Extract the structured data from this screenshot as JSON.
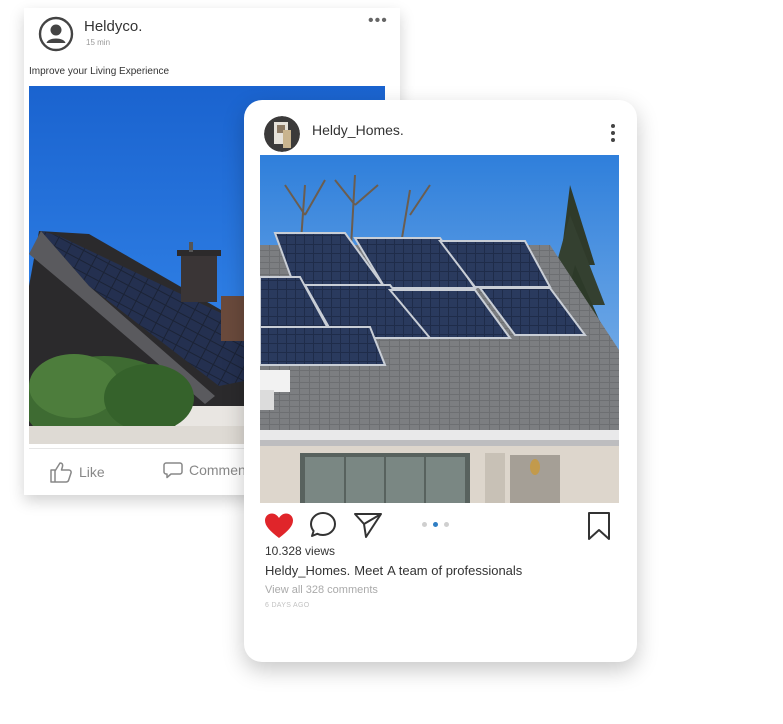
{
  "facebook_post": {
    "author": "Heldyco.",
    "time": "15 min",
    "more_icon": "more-horizontal-icon",
    "caption": "Improve your Living Experience",
    "actions": {
      "like_label": "Like",
      "comment_label": "Comment"
    }
  },
  "instagram_post": {
    "username": "Heldy_Homes.",
    "more_icon": "more-vertical-icon",
    "views": "10.328 views",
    "caption_user": "Heldy_Homes.",
    "caption_meet": "Meet",
    "caption_text": "A team of professionals",
    "view_all_comments": "View all 328 comments",
    "date": "6 DAYS AGO",
    "liked": true,
    "carousel_index": 2,
    "carousel_count": 3
  },
  "colors": {
    "heart": "#e0252a",
    "carousel_active": "#2f7ec4",
    "sky": "#1f6fd6"
  }
}
